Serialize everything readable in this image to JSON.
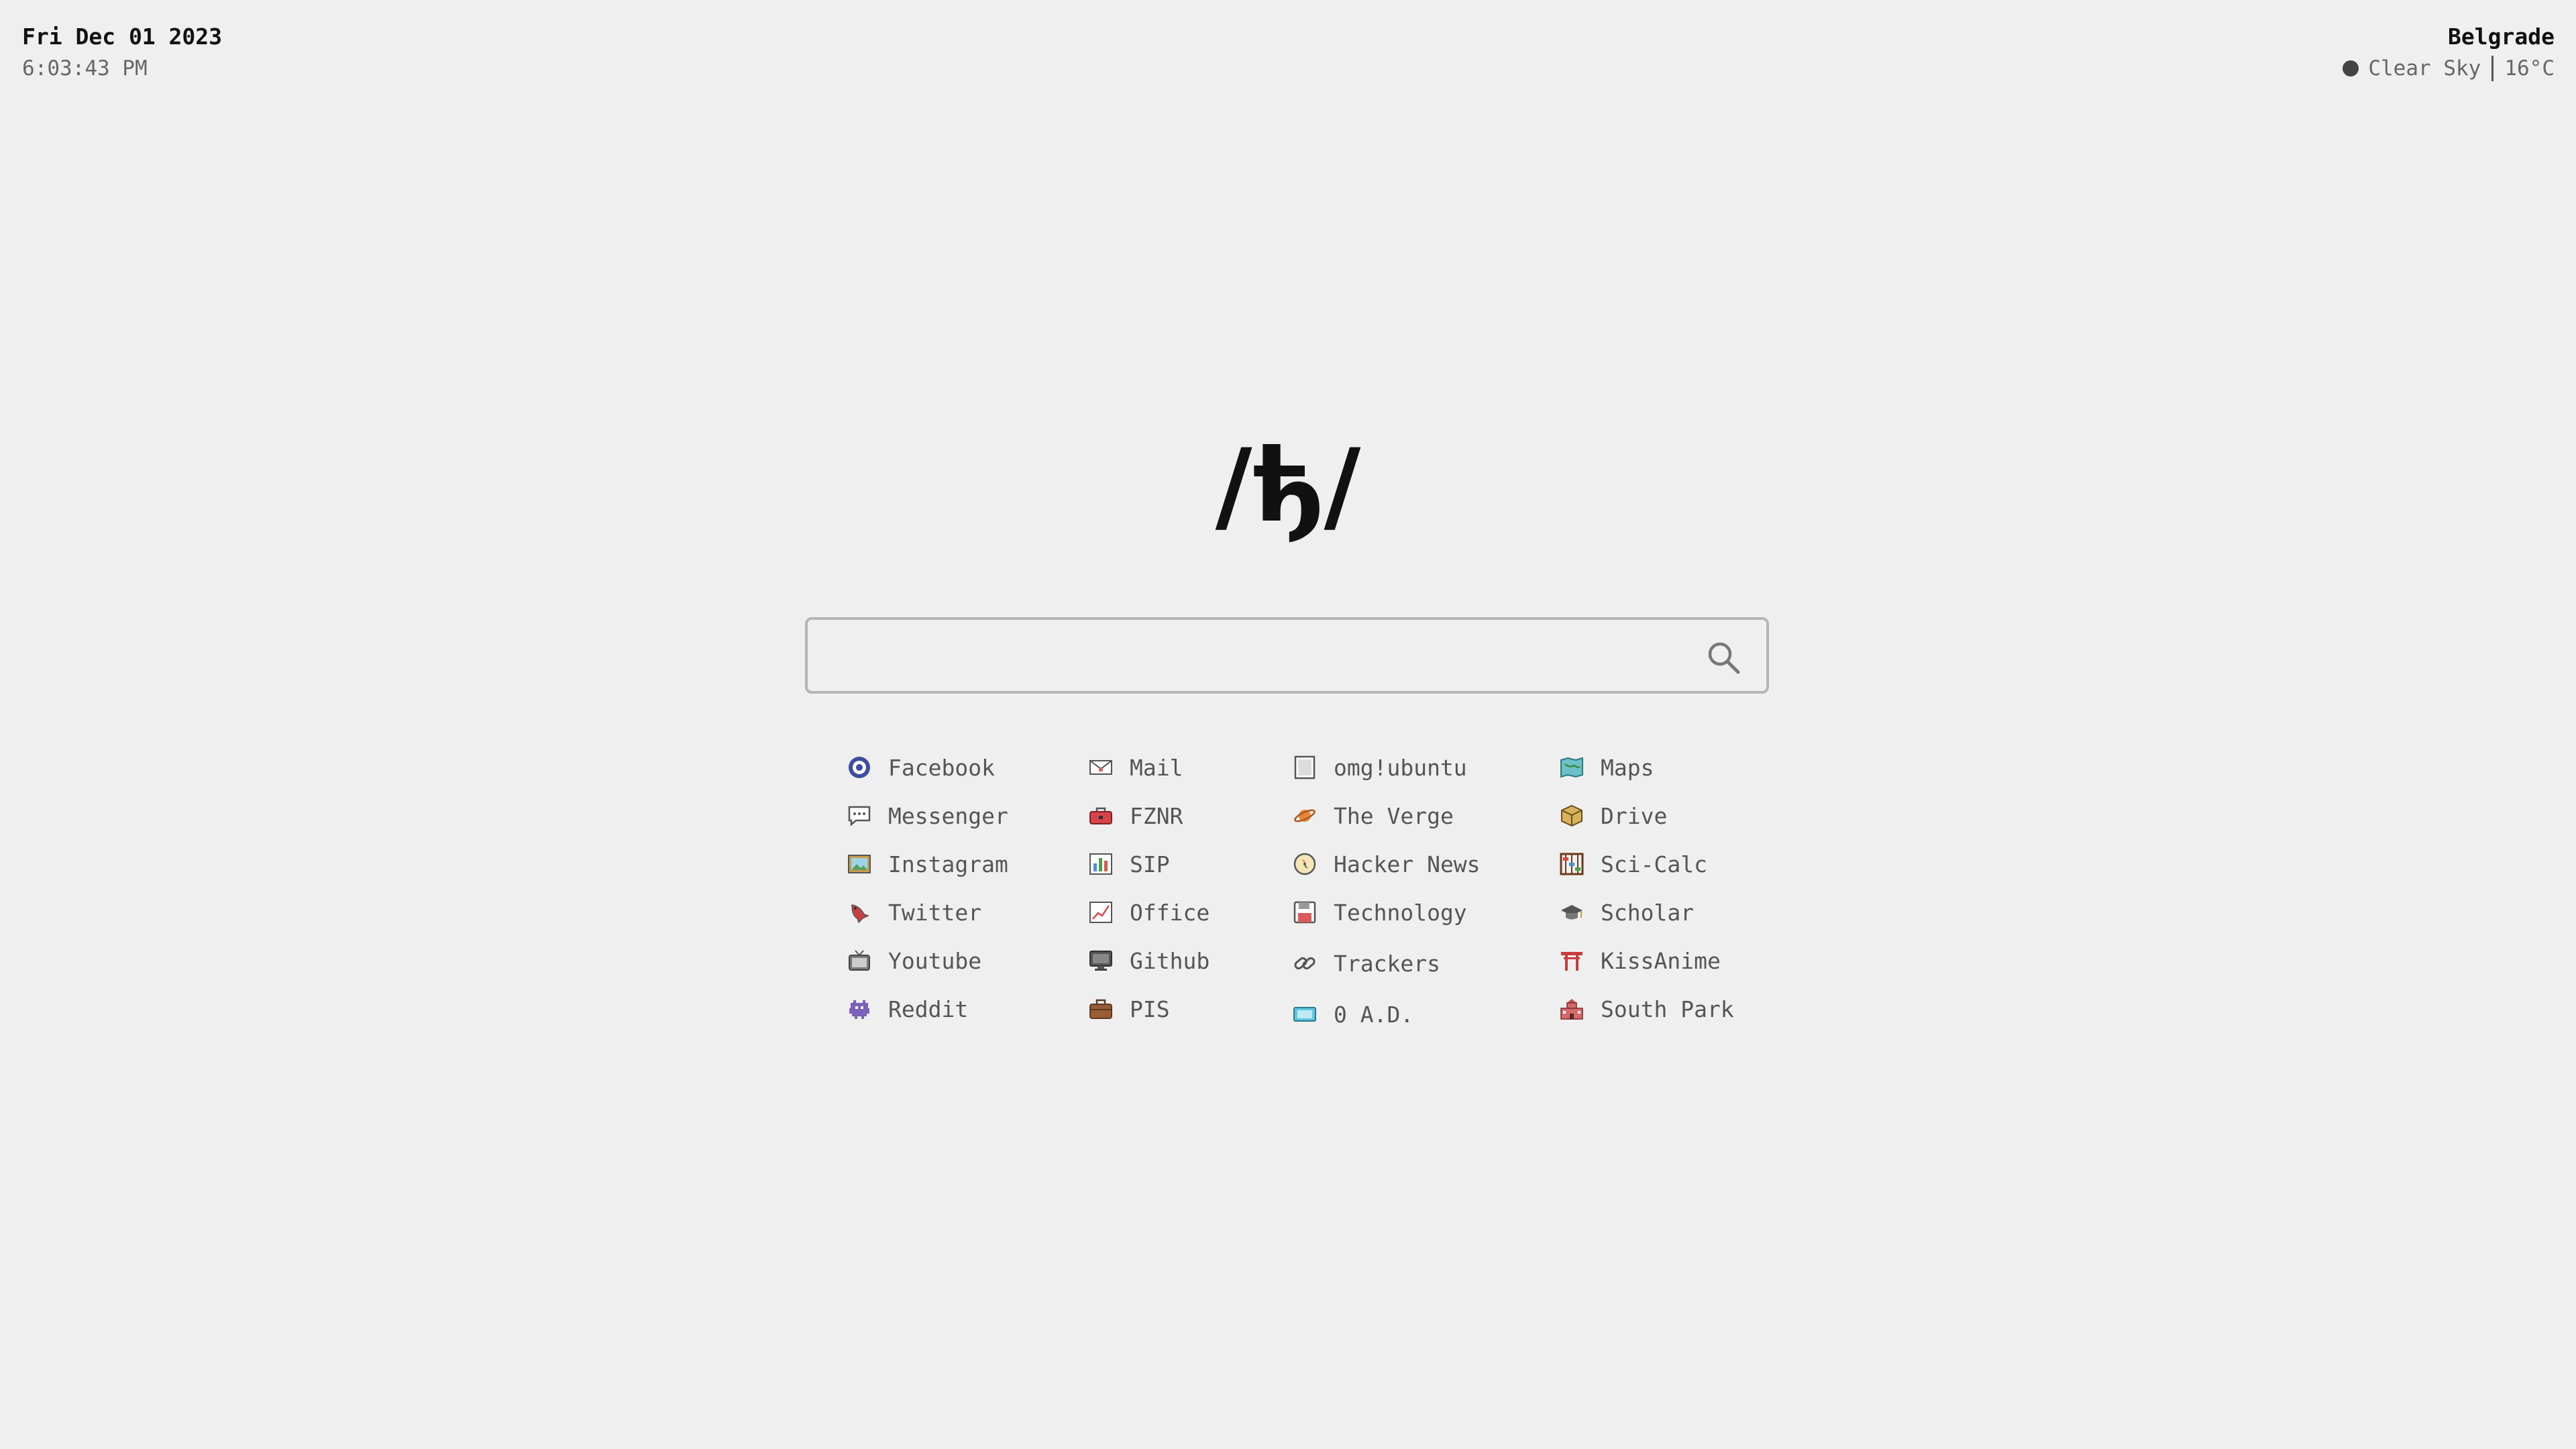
{
  "datetime": {
    "date": "Fri Dec 01 2023",
    "time": "6:03:43 PM"
  },
  "weather": {
    "city": "Belgrade",
    "condition": "Clear Sky",
    "temperature": "16°C"
  },
  "logo": {
    "text": "/ђ/"
  },
  "search": {
    "value": "",
    "placeholder": ""
  },
  "links": {
    "col1": [
      {
        "label": "Facebook",
        "icon": "facebook-icon"
      },
      {
        "label": "Messenger",
        "icon": "speech-bubble-icon"
      },
      {
        "label": "Instagram",
        "icon": "picture-frame-icon"
      },
      {
        "label": "Twitter",
        "icon": "bird-icon"
      },
      {
        "label": "Youtube",
        "icon": "television-icon"
      },
      {
        "label": "Reddit",
        "icon": "alien-monster-icon"
      }
    ],
    "col2": [
      {
        "label": "Mail",
        "icon": "envelope-icon"
      },
      {
        "label": "FZNR",
        "icon": "toolbox-icon"
      },
      {
        "label": "SIP",
        "icon": "bar-chart-icon"
      },
      {
        "label": "Office",
        "icon": "trending-chart-icon"
      },
      {
        "label": "Github",
        "icon": "desktop-computer-icon"
      },
      {
        "label": "PIS",
        "icon": "briefcase-icon"
      }
    ],
    "col3": [
      {
        "label": "omg!ubuntu",
        "icon": "page-icon"
      },
      {
        "label": "The Verge",
        "icon": "ringed-planet-icon"
      },
      {
        "label": "Hacker News",
        "icon": "compass-icon"
      },
      {
        "label": "Technology",
        "icon": "floppy-disk-icon"
      },
      {
        "label": "Trackers",
        "icon": "link-icon"
      },
      {
        "label": "0 A.D.",
        "icon": "game-cartridge-icon"
      }
    ],
    "col4": [
      {
        "label": "Maps",
        "icon": "map-icon"
      },
      {
        "label": "Drive",
        "icon": "package-icon"
      },
      {
        "label": "Sci-Calc",
        "icon": "abacus-icon"
      },
      {
        "label": "Scholar",
        "icon": "graduation-cap-icon"
      },
      {
        "label": "KissAnime",
        "icon": "torii-gate-icon"
      },
      {
        "label": "South Park",
        "icon": "school-building-icon"
      }
    ]
  },
  "colors": {
    "background": "#efefef",
    "text": "#555555",
    "heading": "#111111",
    "search_border": "#b5b5b5"
  }
}
